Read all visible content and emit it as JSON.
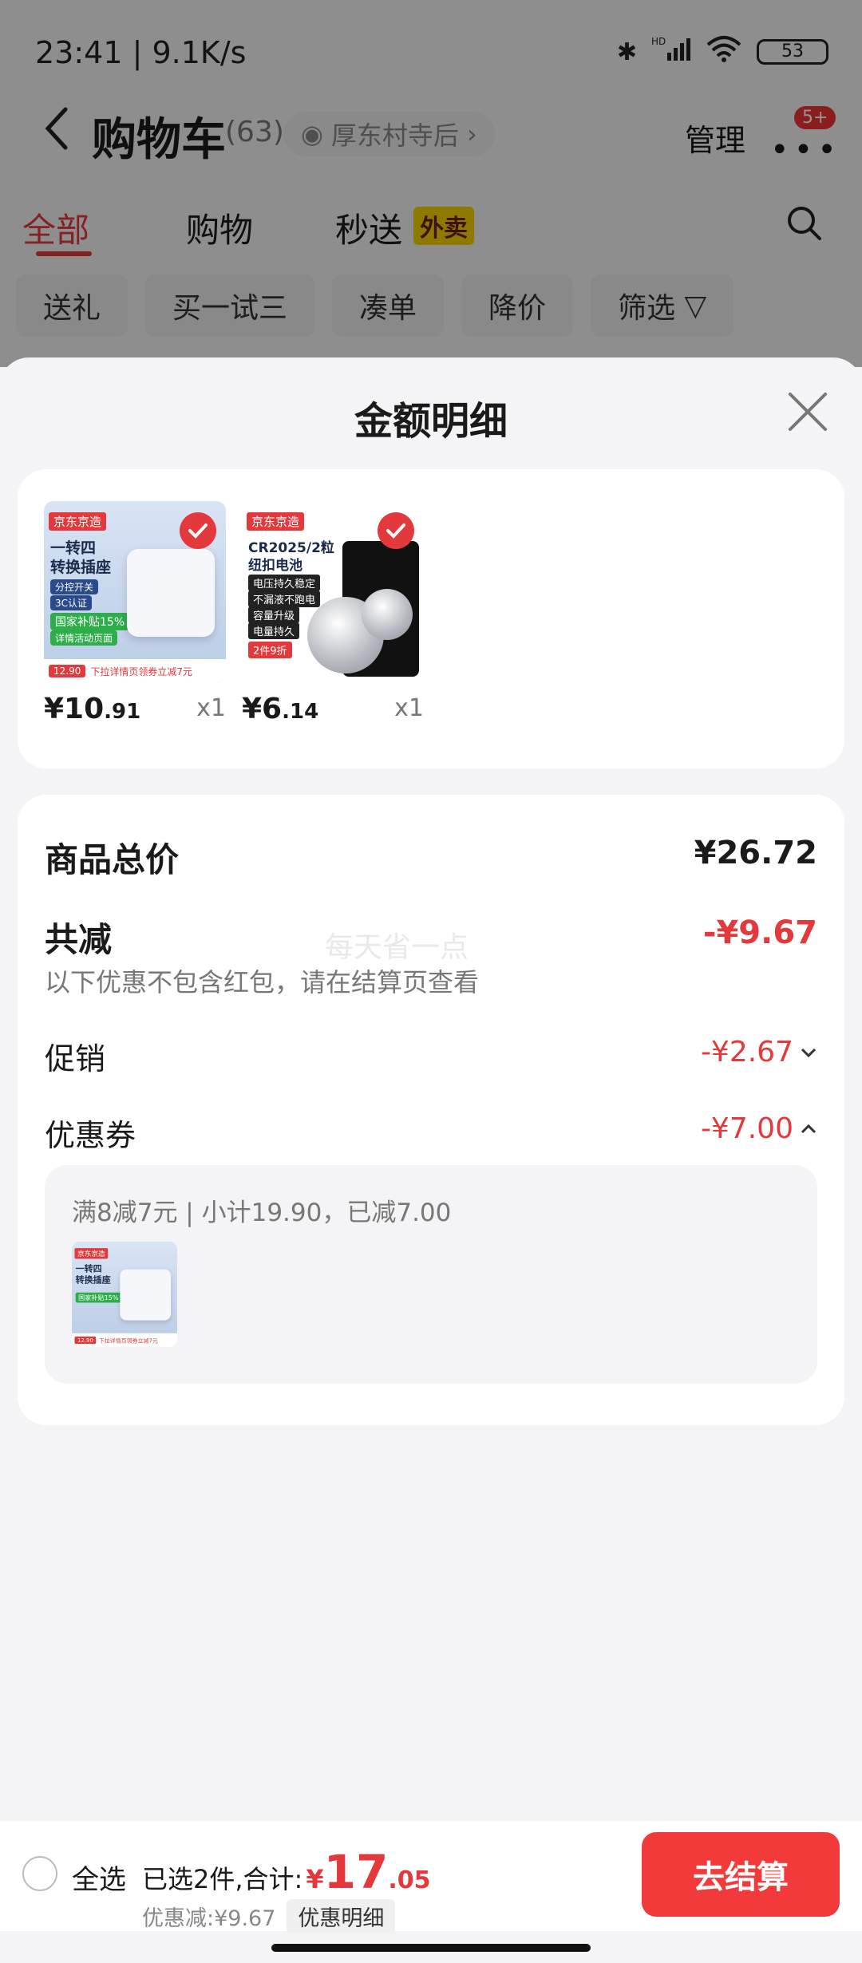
{
  "status_bar": {
    "time": "23:41 | 9.1K/s",
    "battery": "53",
    "hd_label": "HD"
  },
  "nav": {
    "title": "购物车",
    "count": "(63)",
    "address": "厚东村寺后",
    "manage": "管理",
    "badge": "5+"
  },
  "tabs": [
    {
      "label": "全部",
      "active": true
    },
    {
      "label": "购物"
    },
    {
      "label": "秒送"
    }
  ],
  "tab_tag": "外卖",
  "filter_chips": [
    "送礼",
    "买一试三",
    "凑单",
    "降价",
    "筛选"
  ],
  "sheet": {
    "title": "金额明细",
    "products": [
      {
        "price_int": "¥10",
        "price_dec": ".91",
        "qty": "x1",
        "image_text": {
          "brand": "京东京造",
          "line1": "一转四",
          "line2": "转换插座",
          "pill1": "分控开关",
          "pill2": "3C认证",
          "green": "国家补贴15%",
          "green2": "详情活动页面",
          "footer_price": "12.90",
          "footer_note": "下拉详情页领券立减7元"
        }
      },
      {
        "price_int": "¥6",
        "price_dec": ".14",
        "qty": "x1",
        "image_text": {
          "brand": "京东京造",
          "line1": "CR2025/2粒",
          "line2": "纽扣电池",
          "b1": "电压持久稳定",
          "b2": "不漏液不跑电",
          "b3": "容量升级",
          "b4": "电量持久",
          "b5": "2件9折"
        }
      }
    ],
    "summary": {
      "total_label": "商品总价",
      "total_value": "¥26.72",
      "discount_label": "共减",
      "discount_value": "-¥9.67",
      "discount_note": "以下优惠不包含红包，请在结算页查看",
      "watermark": "每天省一点",
      "promo_label": "促销",
      "promo_value": "-¥2.67",
      "coupon_label": "优惠券",
      "coupon_value": "-¥7.00",
      "coupon_detail": "满8减7元 | 小计19.90，已减7.00"
    }
  },
  "bottom_bar": {
    "select_all": "全选",
    "selected_text": "已选2件,合计:",
    "total_yen": "¥",
    "total_int": "17",
    "total_dec": ".05",
    "discount_text": "优惠减:¥9.67",
    "detail_button": "优惠明细",
    "checkout": "去结算"
  },
  "colors": {
    "accent_red": "#e4393c",
    "checkout_red": "#f33a3a",
    "tag_yellow": "#f7d200"
  }
}
